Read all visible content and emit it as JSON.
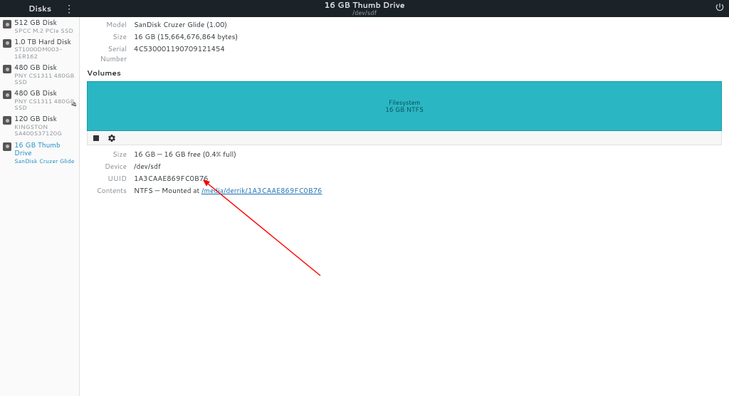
{
  "header": {
    "app_title": "Disks",
    "drive_title": "16 GB Thumb Drive",
    "drive_sub": "/dev/sdf"
  },
  "sidebar": {
    "items": [
      {
        "name": "512 GB Disk",
        "sub": "SPCC M.2 PCIe SSD"
      },
      {
        "name": "1.0 TB Hard Disk",
        "sub": "ST1000DM003-1ER162"
      },
      {
        "name": "480 GB Disk",
        "sub": "PNY CS1311 480GB SSD"
      },
      {
        "name": "480 GB Disk",
        "sub": "PNY CS1311 480GB SSD"
      },
      {
        "name": "120 GB Disk",
        "sub": "KINGSTON SA400S37120G"
      },
      {
        "name": "16 GB Thumb Drive",
        "sub": "SanDisk Cruzer Glide"
      }
    ]
  },
  "drive": {
    "model_label": "Model",
    "model": "SanDisk Cruzer Glide (1.00)",
    "size_label": "Size",
    "size": "16 GB (15,664,676,864 bytes)",
    "serial_label": "Serial Number",
    "serial": "4C530001190709121454"
  },
  "volumes_title": "Volumes",
  "volume": {
    "label1": "Filesystem",
    "label2": "16 GB NTFS"
  },
  "partition": {
    "size_label": "Size",
    "size": "16 GB — 16 GB free (0.4% full)",
    "device_label": "Device",
    "device": "/dev/sdf",
    "uuid_label": "UUID",
    "uuid": "1A3CAAE869FC0B76",
    "contents_label": "Contents",
    "contents_prefix": "NTFS — Mounted at ",
    "mount_path": "/media/derrik/1A3CAAE869FC0B76"
  }
}
